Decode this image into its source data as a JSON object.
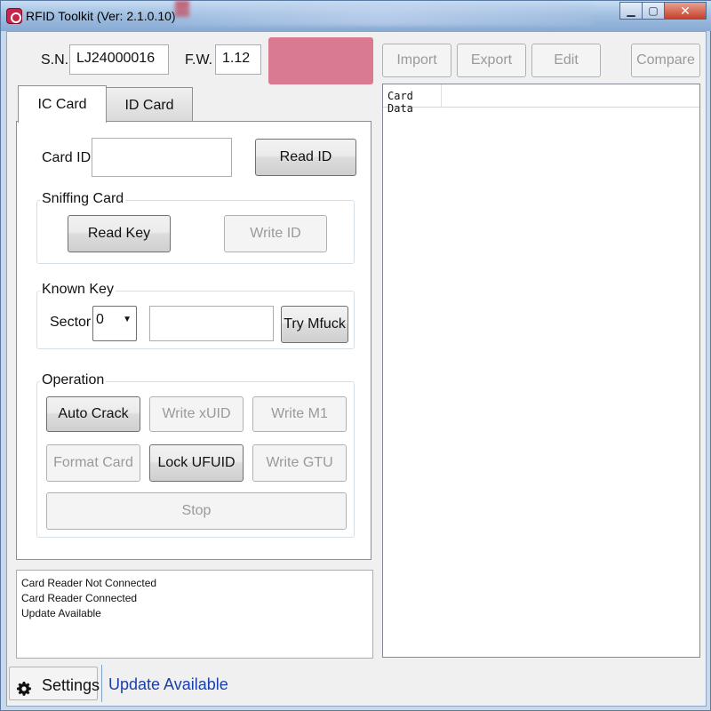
{
  "window": {
    "title": "RFID Toolkit (Ver: 2.1.0.10)",
    "controls": {
      "minimize": "▁",
      "maximize": "▢",
      "close": "✕"
    }
  },
  "device": {
    "sn_label": "S.N.",
    "sn_value": "LJ24000016",
    "fw_label": "F.W.",
    "fw_value": "1.12",
    "indicator_color": "#d97a90"
  },
  "toolbar": {
    "import": "Import",
    "export": "Export",
    "edit": "Edit",
    "compare": "Compare"
  },
  "tabs": [
    {
      "label": "IC Card",
      "active": true
    },
    {
      "label": "ID Card",
      "active": false
    }
  ],
  "card_id": {
    "label": "Card ID",
    "value": "",
    "read_button": "Read ID"
  },
  "sniffing": {
    "title": "Sniffing Card",
    "read_key": "Read Key",
    "write_id": "Write ID"
  },
  "known_key": {
    "title": "Known Key",
    "sector_label": "Sector",
    "sector_value": "0",
    "key_value": "",
    "try_button": "Try Mfuck"
  },
  "operation": {
    "title": "Operation",
    "auto_crack": "Auto Crack",
    "write_xuid": "Write xUID",
    "write_m1": "Write M1",
    "format_card": "Format Card",
    "lock_ufuid": "Lock UFUID",
    "write_gtu": "Write GTU",
    "stop": "Stop"
  },
  "log": [
    "Card Reader Not Connected",
    "Card Reader Connected",
    "Update Available"
  ],
  "status_bar": {
    "settings": "Settings",
    "message": "Update Available"
  },
  "card_data": {
    "column_header": "Card Data"
  }
}
